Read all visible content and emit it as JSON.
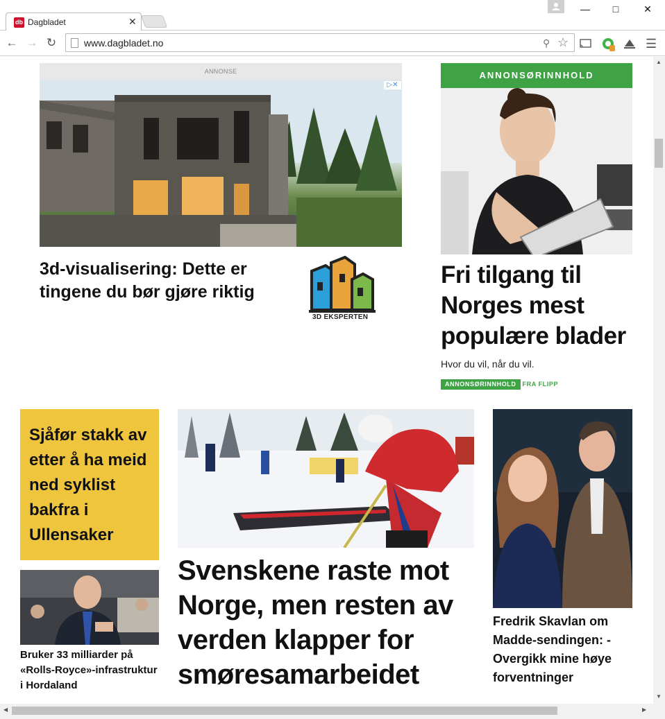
{
  "browser": {
    "tab_title": "Dagbladet",
    "favicon_text": "db",
    "url": "www.dagbladet.no",
    "minimize": "—",
    "maximize": "□",
    "close": "✕",
    "tab_close": "✕"
  },
  "ad": {
    "label": "ANNONSE",
    "headline": "3d-visualisering: Dette er tingene du bør gjøre riktig",
    "logo_text": "3D EKSPERTEN"
  },
  "sponsored": {
    "header": "ANNONSØRINNHOLD",
    "title": "Fri tilgang til Norges mest populære blader",
    "subtitle": "Hvor du vil, når du vil.",
    "tag": "ANNONSØRINNHOLD",
    "source": "FRA FLIPP"
  },
  "stories": {
    "yellow": {
      "headline": "Sjåfør stakk av etter å ha meid ned syklist bakfra i Ullensaker"
    },
    "small": {
      "headline": "Bruker 33 milliarder på «Rolls-Royce»-infrastruktur i Hordaland"
    },
    "main": {
      "headline": "Svenskene raste mot Norge, men resten av verden klapper for smøresamarbeidet"
    },
    "right": {
      "headline": "Fredrik Skavlan om Madde-sendingen: - Overgikk mine høye forventninger"
    }
  },
  "colors": {
    "accent_green": "#3fa346",
    "accent_yellow": "#f0c53e",
    "brand_red": "#d0112b"
  }
}
